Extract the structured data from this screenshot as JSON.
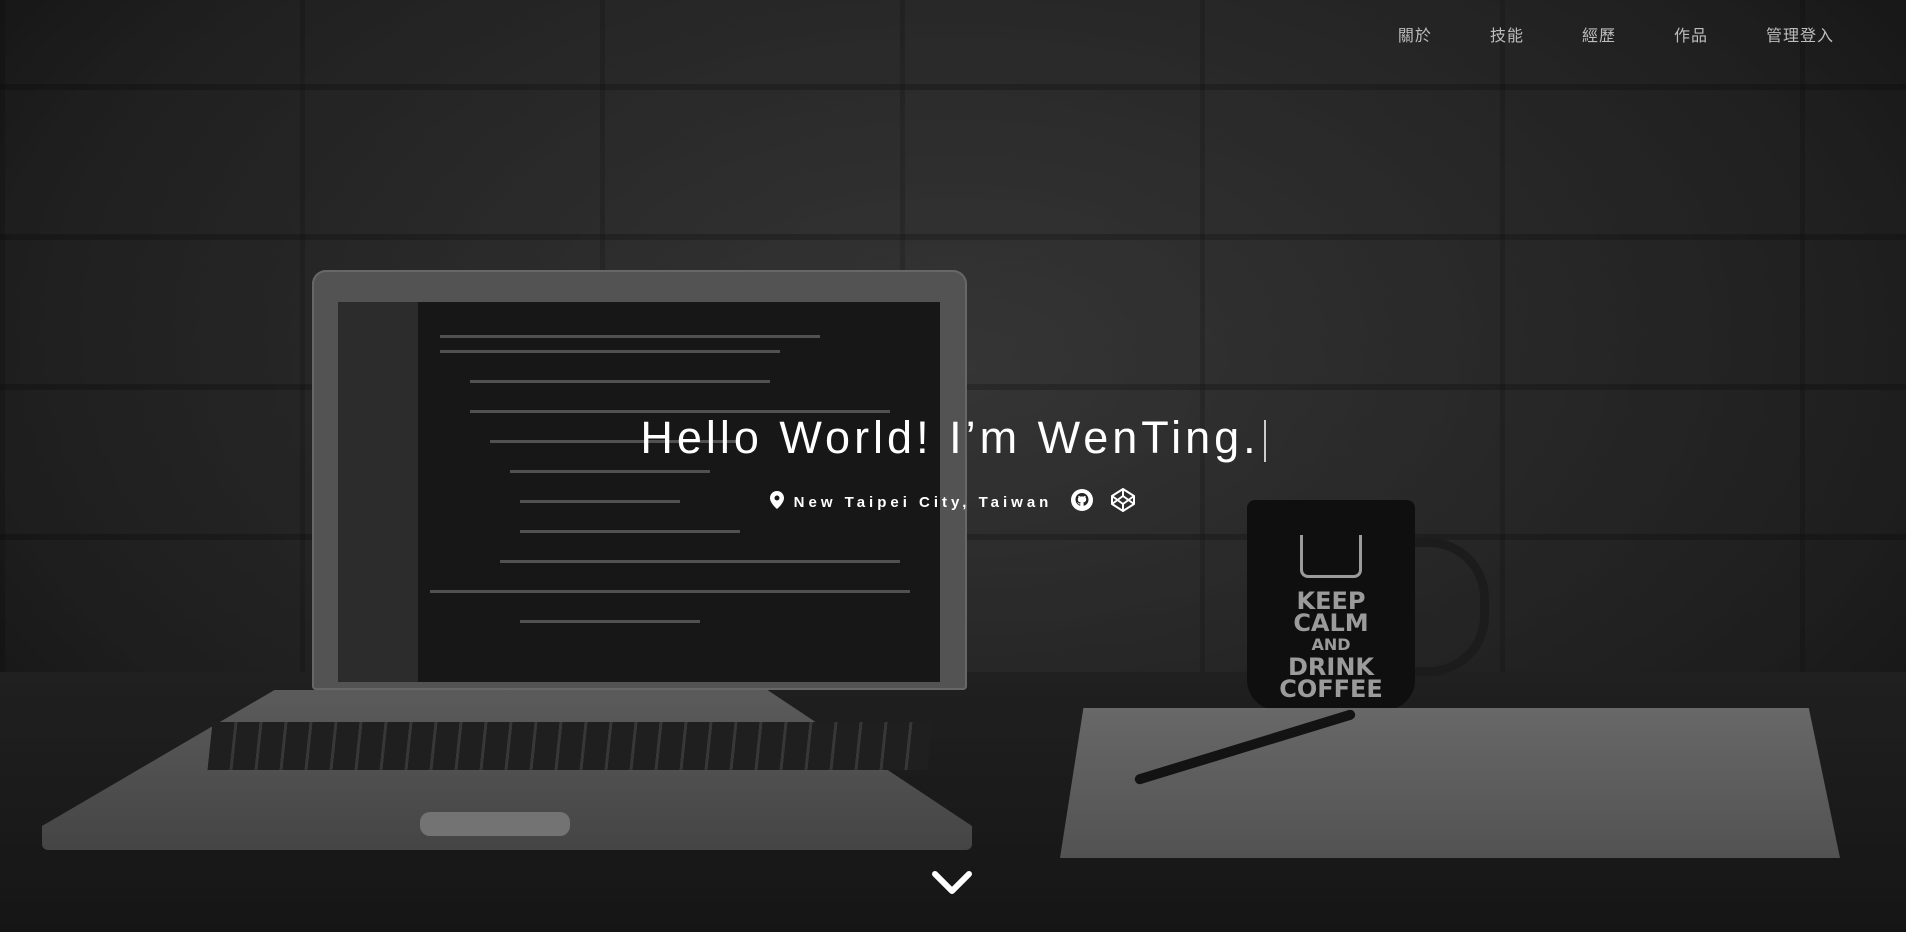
{
  "nav": {
    "items": [
      {
        "label": "關於"
      },
      {
        "label": "技能"
      },
      {
        "label": "經歷"
      },
      {
        "label": "作品"
      },
      {
        "label": "管理登入"
      }
    ]
  },
  "hero": {
    "headline": "Hello World! I’m WenTing.",
    "location": "New Taipei City, Taiwan",
    "icons": {
      "location": "map-pin-icon",
      "github": "github-icon",
      "codepen": "codepen-icon",
      "scroll": "chevron-down-icon"
    }
  },
  "background": {
    "mug_text": {
      "line1": "KEEP",
      "line2": "CALM",
      "line3": "AND",
      "line4": "DRINK",
      "line5": "COFFEE"
    }
  }
}
